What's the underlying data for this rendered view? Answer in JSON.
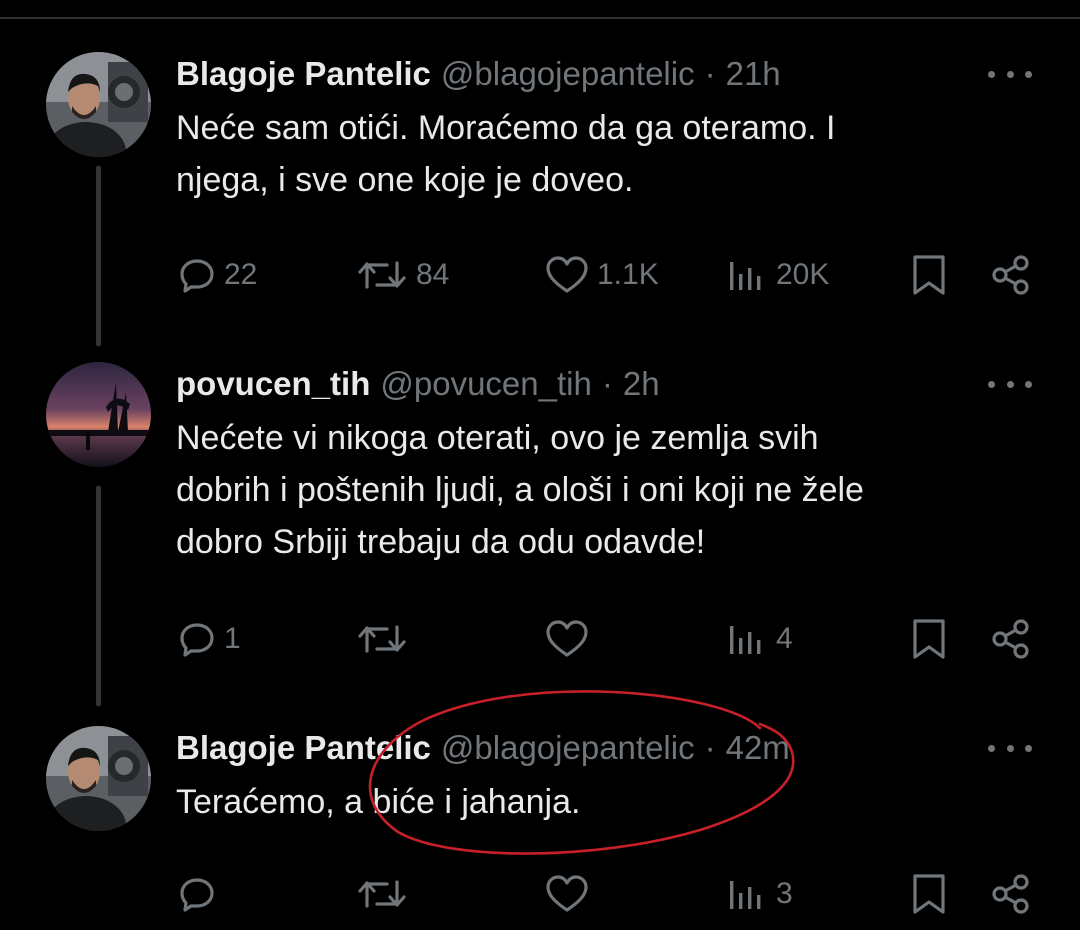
{
  "thread": {
    "tweets": [
      {
        "author": "Blagoje Pantelic",
        "handle": "@blagojepantelic",
        "time": "21h",
        "line1": "Neće sam otići. Moraćemo da ga oteramo. I",
        "line2": "njega, i sve one koje je doveo.",
        "line3": "",
        "replies": "22",
        "reposts": "84",
        "likes": "1.1K",
        "views": "20K",
        "avatar": "photo-man-dark-shirt"
      },
      {
        "author": "povucen_tih",
        "handle": "@povucen_tih",
        "time": "2h",
        "line1": "Nećete vi nikoga oterati, ovo je zemlja svih",
        "line2": "dobrih i poštenih ljudi, a ološi i oni koji ne žele",
        "line3": "dobro Srbiji trebaju da odu odavde!",
        "replies": "1",
        "reposts": "",
        "likes": "",
        "views": "4",
        "avatar": "sunset-lake-silhouette"
      },
      {
        "author": "Blagoje Pantelic",
        "handle": "@blagojepantelic",
        "time": "42m",
        "line1": "Teraćemo, a biće i jahanja.",
        "line2": "",
        "line3": "",
        "replies": "",
        "reposts": "",
        "likes": "",
        "views": "3",
        "avatar": "photo-man-dark-shirt"
      }
    ]
  },
  "separator": "·",
  "icons": {
    "reply": "reply-icon",
    "repost": "repost-icon",
    "like": "heart-icon",
    "views": "views-icon",
    "bookmark": "bookmark-icon",
    "share": "share-icon",
    "more": "more-icon"
  },
  "colors": {
    "background": "#000000",
    "text": "#e7e9ea",
    "muted": "#71767b",
    "thread_line": "#333639",
    "annotation": "#c8202a"
  }
}
